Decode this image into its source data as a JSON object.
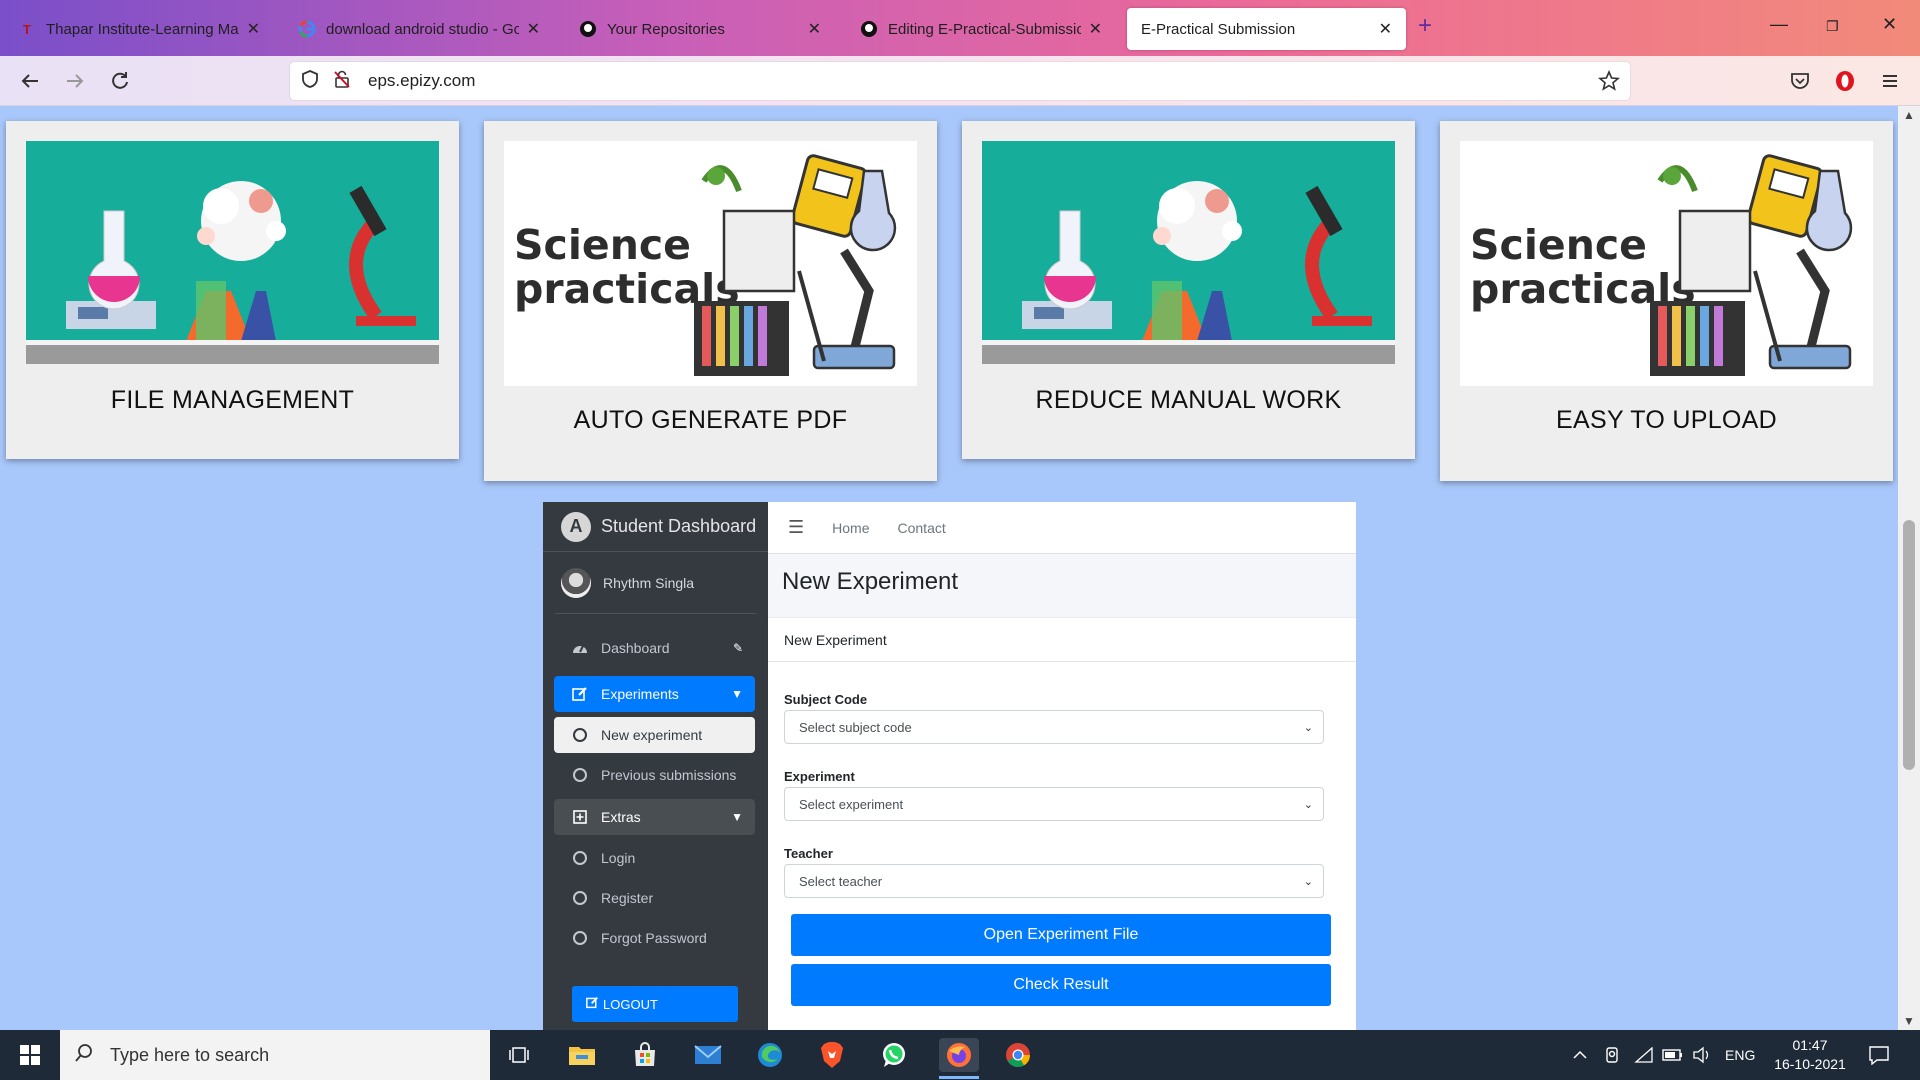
{
  "browser": {
    "tabs": [
      {
        "title": "Thapar Institute-Learning Mana",
        "icon": "thapar-favicon"
      },
      {
        "title": "download android studio - Goo",
        "icon": "google-favicon"
      },
      {
        "title": "Your Repositories",
        "icon": "github-favicon"
      },
      {
        "title": "Editing E-Practical-Submissions",
        "icon": "github-favicon"
      },
      {
        "title": "E-Practical Submission",
        "icon": "page-favicon"
      }
    ],
    "url_domain": "eps.epizy.com"
  },
  "features": [
    {
      "caption": "FILE MANAGEMENT"
    },
    {
      "caption": "AUTO GENERATE PDF",
      "image_text_1": "Science",
      "image_text_2": "practicals"
    },
    {
      "caption": "REDUCE MANUAL WORK"
    },
    {
      "caption": "EASY TO UPLOAD",
      "image_text_1": "Science",
      "image_text_2": "practicals"
    }
  ],
  "dashboard": {
    "brand": "Student Dashboard",
    "user": "Rhythm Singla",
    "nav": {
      "dashboard": "Dashboard",
      "experiments": "Experiments",
      "new_experiment": "New experiment",
      "previous_submissions": "Previous submissions",
      "extras": "Extras",
      "login": "Login",
      "register": "Register",
      "forgot_password": "Forgot Password",
      "logout": "LOGOUT"
    },
    "topnav": {
      "home": "Home",
      "contact": "Contact"
    },
    "page_title": "New Experiment",
    "card_header": "New Experiment",
    "form": {
      "subject_label": "Subject Code",
      "subject_value": "Select subject code",
      "experiment_label": "Experiment",
      "experiment_value": "Select experiment",
      "teacher_label": "Teacher",
      "teacher_value": "Select teacher"
    },
    "buttons": {
      "open": "Open Experiment File",
      "check": "Check Result"
    },
    "colors": {
      "primary": "#007bff",
      "sidebar": "#343a40"
    }
  },
  "taskbar": {
    "search_placeholder": "Type here to search",
    "language": "ENG",
    "time": "01:47",
    "date": "16-10-2021"
  }
}
